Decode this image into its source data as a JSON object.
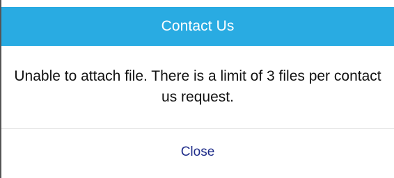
{
  "dialog": {
    "title": "Contact Us",
    "message": "Unable to attach file. There is a limit of 3 files per contact us request.",
    "close_label": "Close"
  },
  "colors": {
    "header_background": "#29abe2",
    "header_text": "#ffffff",
    "close_text": "#1f2d8a"
  }
}
